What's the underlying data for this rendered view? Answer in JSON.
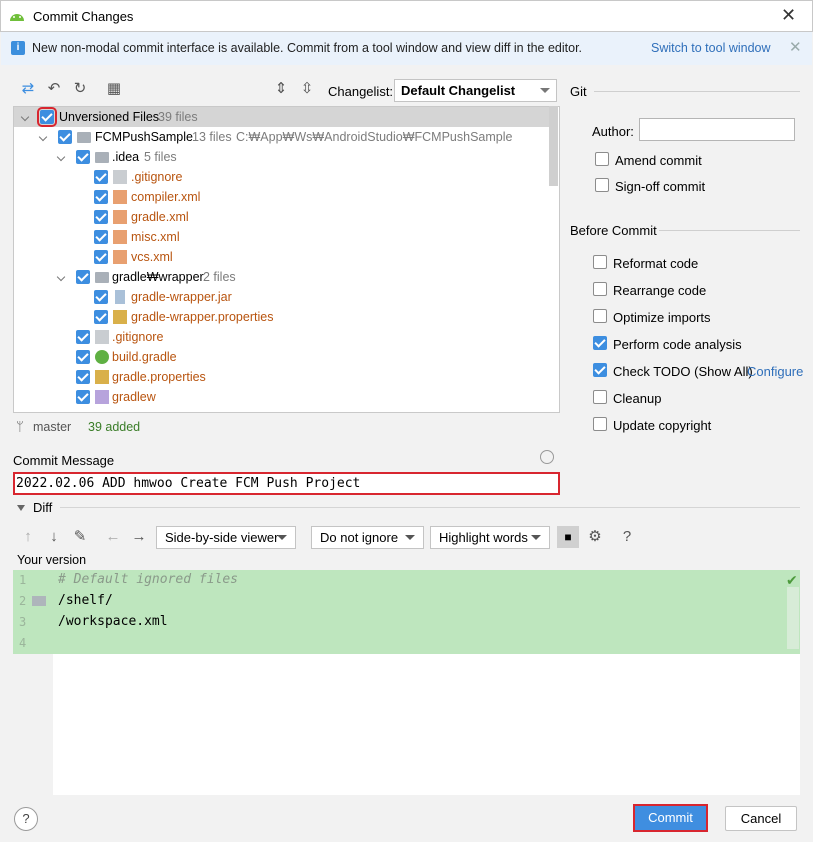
{
  "window": {
    "title": "Commit Changes",
    "close": "✕"
  },
  "banner": {
    "text": "New non-modal commit interface is available. Commit from a tool window and view diff in the editor.",
    "link": "Switch to tool window",
    "close": "✕"
  },
  "toolbar": {
    "changelist_label": "Changelist:",
    "changelist_value": "Default Changelist"
  },
  "tree": {
    "rows": [
      {
        "name": "Unversioned Files",
        "count": "39 files"
      },
      {
        "name": "FCMPushSample",
        "count": "13 files",
        "path": "C:₩App₩Ws₩AndroidStudio₩FCMPushSample"
      },
      {
        "name": ".idea",
        "count": "5 files"
      },
      {
        "name": ".gitignore"
      },
      {
        "name": "compiler.xml"
      },
      {
        "name": "gradle.xml"
      },
      {
        "name": "misc.xml"
      },
      {
        "name": "vcs.xml"
      },
      {
        "name": "gradle₩wrapper",
        "count": "2 files"
      },
      {
        "name": "gradle-wrapper.jar"
      },
      {
        "name": "gradle-wrapper.properties"
      },
      {
        "name": ".gitignore"
      },
      {
        "name": "build.gradle"
      },
      {
        "name": "gradle.properties"
      },
      {
        "name": "gradlew"
      }
    ]
  },
  "status": {
    "branch": "master",
    "added": "39 added"
  },
  "git": {
    "section": "Git",
    "author_label": "Author:",
    "author_value": "",
    "amend": "Amend commit",
    "signoff": "Sign-off commit"
  },
  "before_commit": {
    "section": "Before Commit",
    "options": [
      {
        "label": "Reformat code",
        "checked": false
      },
      {
        "label": "Rearrange code",
        "checked": false
      },
      {
        "label": "Optimize imports",
        "checked": false
      },
      {
        "label": "Perform code analysis",
        "checked": true
      },
      {
        "label": "Check TODO (Show All)",
        "checked": true
      },
      {
        "label": "Cleanup",
        "checked": false
      },
      {
        "label": "Update copyright",
        "checked": false
      }
    ],
    "configure_link": "Configure"
  },
  "commit_message": {
    "label": "Commit Message",
    "value": "2022.02.06 ADD hmwoo Create FCM Push Project"
  },
  "diff": {
    "label": "Diff",
    "viewer": "Side-by-side viewer",
    "ignore": "Do not ignore",
    "highlight": "Highlight words",
    "help": "?",
    "your_version": "Your version",
    "lines": [
      {
        "num": "1",
        "text": "# Default ignored files"
      },
      {
        "num": "2",
        "text": "/shelf/"
      },
      {
        "num": "3",
        "text": "/workspace.xml"
      },
      {
        "num": "4",
        "text": ""
      }
    ]
  },
  "buttons": {
    "help": "?",
    "commit": "Commit",
    "cancel": "Cancel"
  },
  "colors": {
    "accent": "#3d8ee0",
    "highlight": "#d8262f",
    "diff_added": "#bee6be",
    "file_new": "#b8540f"
  }
}
